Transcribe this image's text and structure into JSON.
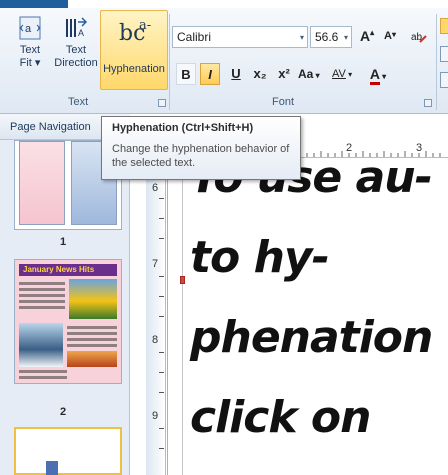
{
  "ribbon": {
    "text_fit_label": "Text\nFit ▾",
    "text_direction_label": "Text\nDirection",
    "hyphenation_label": "Hyphenation",
    "hyphenation_glyph": "bc",
    "hyphenation_glyph_sup": "a-",
    "text_group_label": "Text",
    "font_group_label": "Font",
    "font_name": "Calibri",
    "font_size": "56.6",
    "bold": "B",
    "italic": "I",
    "underline": "U",
    "subscript": "x₂",
    "superscript": "x²",
    "change_case": "Aa",
    "spacing": "AV",
    "font_color": "A",
    "grow": "A",
    "shrink": "A"
  },
  "nav": {
    "title": "Page Navigation",
    "pages": [
      {
        "number": "1"
      },
      {
        "number": "2",
        "headline": "January News Hits"
      }
    ]
  },
  "ruler": {
    "h_numbers": [
      "2",
      "3"
    ],
    "v_numbers": [
      "6",
      "7",
      "8",
      "9"
    ]
  },
  "document": {
    "lines": [
      "To use au-",
      "to hy-",
      "phenation",
      "click on"
    ]
  },
  "tooltip": {
    "title": "Hyphenation (Ctrl+Shift+H)",
    "body": "Change the hyphenation behavior of the selected text."
  },
  "colors": {
    "accent": "#1f5f9e",
    "hyphenation_active": "#ffd86b"
  }
}
